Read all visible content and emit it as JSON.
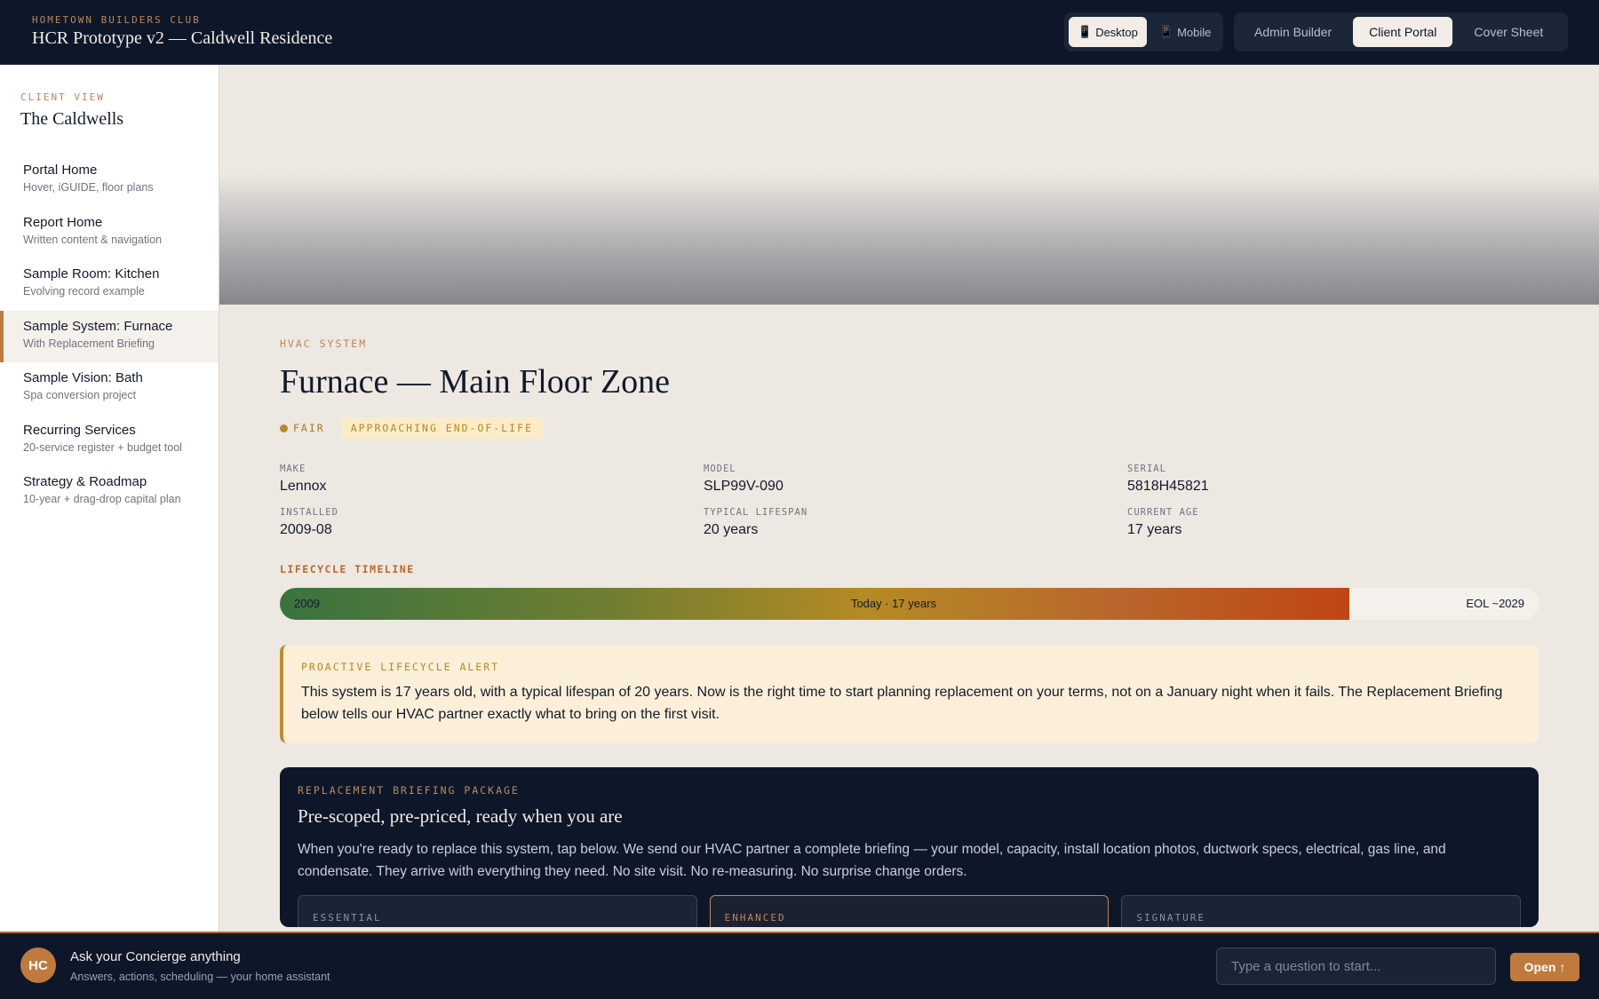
{
  "header": {
    "brand_small": "HOMETOWN BUILDERS CLUB",
    "title": "HCR Prototype v2 — Caldwell Residence",
    "device_toggle": [
      {
        "icon": "📱",
        "label": "Desktop",
        "active": true
      },
      {
        "icon": "📱",
        "label": "Mobile",
        "active": false
      }
    ],
    "views": [
      {
        "label": "Admin Builder",
        "active": false
      },
      {
        "label": "Client Portal",
        "active": true
      },
      {
        "label": "Cover Sheet",
        "active": false
      }
    ]
  },
  "sidebar": {
    "kicker": "CLIENT VIEW",
    "title": "The Caldwells",
    "items": [
      {
        "label": "Portal Home",
        "sub": "Hover, iGUIDE, floor plans"
      },
      {
        "label": "Report Home",
        "sub": "Written content & navigation"
      },
      {
        "label": "Sample Room: Kitchen",
        "sub": "Evolving record example"
      },
      {
        "label": "Sample System: Furnace",
        "sub": "With Replacement Briefing",
        "active": true
      },
      {
        "label": "Sample Vision: Bath",
        "sub": "Spa conversion project"
      },
      {
        "label": "Recurring Services",
        "sub": "20-service register + budget tool"
      },
      {
        "label": "Strategy & Roadmap",
        "sub": "10-year + drag-drop capital plan"
      }
    ]
  },
  "main": {
    "kicker": "HVAC SYSTEM",
    "title": "Furnace — Main Floor Zone",
    "condition": "FAIR",
    "condition_color": "#b58a23",
    "status_tag": "APPROACHING END-OF-LIFE",
    "specs": {
      "make": {
        "label": "MAKE",
        "value": "Lennox"
      },
      "model": {
        "label": "MODEL",
        "value": "SLP99V-090"
      },
      "serial": {
        "label": "SERIAL",
        "value": "5818H45821"
      },
      "installed": {
        "label": "INSTALLED",
        "value": "2009-08"
      },
      "lifespan": {
        "label": "TYPICAL LIFESPAN",
        "value": "20 years"
      },
      "age": {
        "label": "CURRENT AGE",
        "value": "17 years"
      }
    },
    "timeline": {
      "label": "LIFECYCLE TIMELINE",
      "start": "2009",
      "today": "Today · 17 years",
      "end": "EOL ~2029",
      "progress": 0.85
    },
    "alert": {
      "kicker": "PROACTIVE LIFECYCLE ALERT",
      "text": "This system is 17 years old, with a typical lifespan of 20 years. Now is the right time to start planning replacement on your terms, not on a January night when it fails. The Replacement Briefing below tells our HVAC partner exactly what to bring on the first visit."
    },
    "briefing": {
      "kicker": "REPLACEMENT BRIEFING PACKAGE",
      "title": "Pre-scoped, pre-priced, ready when you are",
      "text": "When you're ready to replace this system, tap below. We send our HVAC partner a complete briefing — your model, capacity, install location photos, ductwork specs, electrical, gas line, and condensate. They arrive with everything they need. No site visit. No re-measuring. No surprise change orders.",
      "tiers": [
        "ESSENTIAL",
        "ENHANCED",
        "SIGNATURE"
      ]
    }
  },
  "footer": {
    "avatar": "HC",
    "title": "Ask your Concierge anything",
    "sub": "Answers, actions, scheduling — your home assistant",
    "input_placeholder": "Type a question to start...",
    "open_label": "Open",
    "open_icon": "↑"
  },
  "colors": {
    "navy": "#0e1729",
    "accent": "#c07a3e",
    "cream": "#ede8e1"
  }
}
